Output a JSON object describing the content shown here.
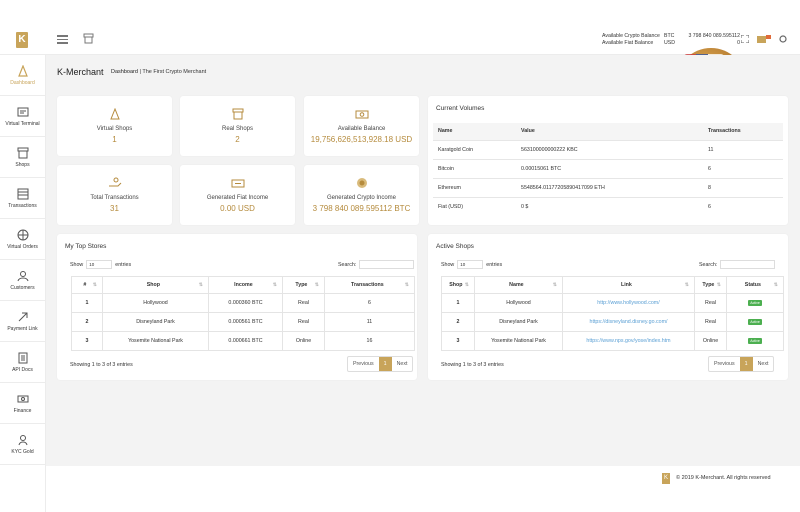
{
  "header": {
    "logo": "K",
    "balances": [
      {
        "label": "Available Crypto Balance",
        "currency": "BTC",
        "value": "3 798 840 089.595112"
      },
      {
        "label": "Available Fiat Balance",
        "currency": "USD",
        "value": "0"
      }
    ]
  },
  "sidebar": {
    "items": [
      {
        "label": "Dashboard",
        "icon": "dashboard-icon",
        "active": true
      },
      {
        "label": "Virtual Terminal",
        "icon": "terminal-icon"
      },
      {
        "label": "Shops",
        "icon": "shop-icon"
      },
      {
        "label": "Transactions",
        "icon": "transactions-icon"
      },
      {
        "label": "Virtual Orders",
        "icon": "globe-icon"
      },
      {
        "label": "Customers",
        "icon": "user-icon"
      },
      {
        "label": "Payment Link",
        "icon": "link-icon"
      },
      {
        "label": "API Docs",
        "icon": "doc-icon"
      },
      {
        "label": "Finance",
        "icon": "finance-icon"
      },
      {
        "label": "KYC Gold",
        "icon": "kyc-icon"
      }
    ]
  },
  "page": {
    "title": "K-Merchant",
    "crumb_active": "Dashboard",
    "crumb_sep": "|",
    "crumb_sub": "The First Crypto Merchant"
  },
  "stats": [
    {
      "label": "Virtual Shops",
      "value": "1"
    },
    {
      "label": "Real Shops",
      "value": "2"
    },
    {
      "label": "Available Balance",
      "value": "19,756,626,513,928.18 USD"
    },
    {
      "label": "Total Transactions",
      "value": "31"
    },
    {
      "label": "Generated Fiat Income",
      "value": "0.00 USD"
    },
    {
      "label": "Generated Crypto Income",
      "value": "3 798 840 089.595112 BTC"
    }
  ],
  "volumes": {
    "title": "Current Volumes",
    "headers": [
      "Name",
      "Value",
      "Transactions"
    ],
    "rows": [
      [
        "Karatgold Coin",
        "563100000000222 KBC",
        "11"
      ],
      [
        "Bitcoin",
        "0.00015061 BTC",
        "6"
      ],
      [
        "Ethereum",
        "5548564.01177205890417099 ETH",
        "8"
      ],
      [
        "Fiat (USD)",
        "0 $",
        "6"
      ]
    ]
  },
  "top_stores": {
    "title": "My Top Stores",
    "show": "Show",
    "entries_value": "10",
    "entries": "entries",
    "search": "Search:",
    "headers": [
      "#",
      "Shop",
      "Income",
      "Type",
      "Transactions"
    ],
    "rows": [
      [
        "1",
        "Hollywood",
        "0.000360 BTC",
        "Real",
        "6"
      ],
      [
        "2",
        "Disneyland Park",
        "0.000561 BTC",
        "Real",
        "11"
      ],
      [
        "3",
        "Yosemite National Park",
        "0.000661 BTC",
        "Online",
        "16"
      ]
    ],
    "info": "Showing 1 to 3 of 3 entries",
    "prev": "Previous",
    "page": "1",
    "next": "Next"
  },
  "active_shops": {
    "title": "Active Shops",
    "show": "Show",
    "entries_value": "10",
    "entries": "entries",
    "search": "Search:",
    "headers": [
      "Shop",
      "Name",
      "Link",
      "Type",
      "Status"
    ],
    "rows": [
      [
        "1",
        "Hollywood",
        "http://www.hollywood.com/",
        "Real",
        "Active"
      ],
      [
        "2",
        "Disneyland Park",
        "https://disneyland.disney.go.com/",
        "Real",
        "Active"
      ],
      [
        "3",
        "Yosemite National Park",
        "https://www.nps.gov/yose/index.htm",
        "Online",
        "Active"
      ]
    ],
    "info": "Showing 1 to 3 of 3 entries",
    "prev": "Previous",
    "page": "1",
    "next": "Next"
  },
  "footer": {
    "logo": "K",
    "text": "© 2019 K-Merchant. All rights reserved"
  },
  "colors": {
    "accent": "#c8a45a",
    "link": "#5a9fd4",
    "active": "#4caf50"
  }
}
